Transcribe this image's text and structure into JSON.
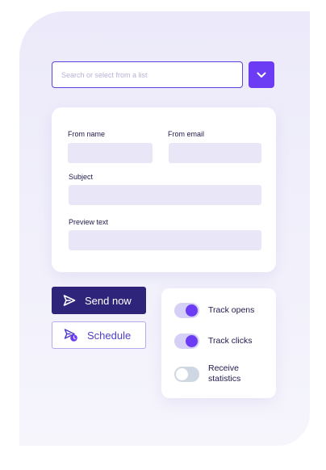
{
  "search": {
    "placeholder": "Search or select from a list"
  },
  "dropdown": {
    "icon": "chevron-down-icon"
  },
  "form": {
    "from_name_label": "From name",
    "from_email_label": "From email",
    "subject_label": "Subject",
    "preview_text_label": "Preview text",
    "from_name_value": "",
    "from_email_value": "",
    "subject_value": "",
    "preview_text_value": ""
  },
  "actions": {
    "send_label": "Send now",
    "send_icon": "paper-plane-icon",
    "schedule_label": "Schedule",
    "schedule_icon": "scheduled-send-icon"
  },
  "toggles": [
    {
      "label": "Track opens",
      "on": true
    },
    {
      "label": "Track clicks",
      "on": true
    },
    {
      "label": "Receive statistics",
      "on": false
    }
  ],
  "colors": {
    "accent": "#6b3cf3",
    "primary_button": "#2e2479",
    "field_fill": "#e9e7f7",
    "panel_background": "#eceafa"
  }
}
